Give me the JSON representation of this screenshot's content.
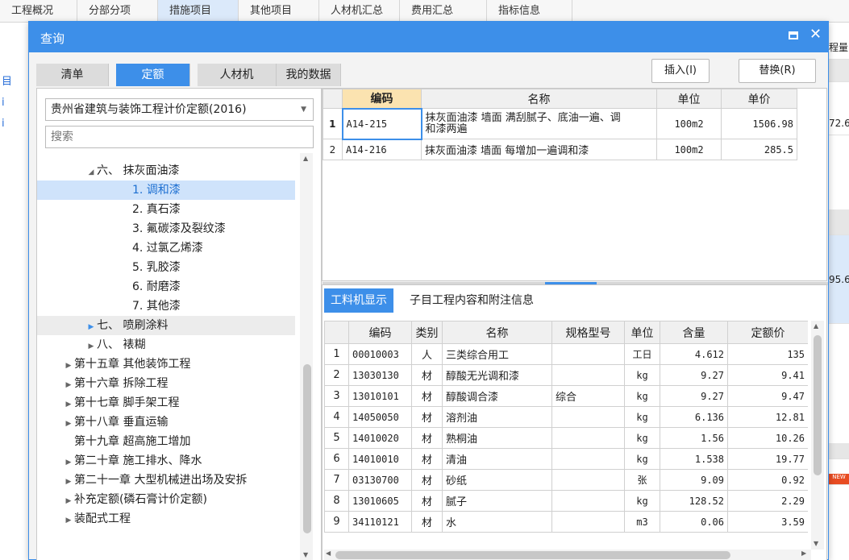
{
  "background": {
    "tabs": [
      "工程概况",
      "分部分项",
      "措施项目",
      "其他项目",
      "人材机汇总",
      "费用汇总",
      "指标信息"
    ],
    "left_items": [
      "目",
      "i",
      "i"
    ],
    "right_cells": [
      "程量",
      "72.6",
      "95.6",
      "NEW"
    ]
  },
  "dialog": {
    "title": "查询",
    "tabs": [
      {
        "label": "清单",
        "active": false
      },
      {
        "label": "定额",
        "active": true
      },
      {
        "label": "人材机",
        "active": false
      },
      {
        "label": "我的数据",
        "active": false
      }
    ],
    "insert_label": "插入(I)",
    "replace_label": "替换(R)"
  },
  "left": {
    "dataset": "贵州省建筑与装饰工程计价定额(2016)",
    "search_placeholder": "搜索",
    "tree": [
      {
        "label": "六、 抹灰面油漆",
        "indent": 60,
        "tri": "◢",
        "state": ""
      },
      {
        "label": "1. 调和漆",
        "indent": 104,
        "tri": "",
        "state": "selected"
      },
      {
        "label": "2. 真石漆",
        "indent": 104,
        "tri": "",
        "state": ""
      },
      {
        "label": "3. 氟碳漆及裂纹漆",
        "indent": 104,
        "tri": "",
        "state": ""
      },
      {
        "label": "4. 过氯乙烯漆",
        "indent": 104,
        "tri": "",
        "state": ""
      },
      {
        "label": "5. 乳胶漆",
        "indent": 104,
        "tri": "",
        "state": ""
      },
      {
        "label": "6. 耐磨漆",
        "indent": 104,
        "tri": "",
        "state": ""
      },
      {
        "label": "7. 其他漆",
        "indent": 104,
        "tri": "",
        "state": ""
      },
      {
        "label": "七、 喷刷涂料",
        "indent": 60,
        "tri": "▶",
        "state": "hover"
      },
      {
        "label": "八、 裱糊",
        "indent": 60,
        "tri": "▶",
        "state": ""
      },
      {
        "label": "第十五章 其他装饰工程",
        "indent": 32,
        "tri": "▶",
        "state": ""
      },
      {
        "label": "第十六章 拆除工程",
        "indent": 32,
        "tri": "▶",
        "state": ""
      },
      {
        "label": "第十七章 脚手架工程",
        "indent": 32,
        "tri": "▶",
        "state": ""
      },
      {
        "label": "第十八章 垂直运输",
        "indent": 32,
        "tri": "▶",
        "state": ""
      },
      {
        "label": "第十九章 超高施工增加",
        "indent": 32,
        "tri": "",
        "state": ""
      },
      {
        "label": "第二十章 施工排水、降水",
        "indent": 32,
        "tri": "▶",
        "state": ""
      },
      {
        "label": "第二十一章 大型机械进出场及安拆",
        "indent": 32,
        "tri": "▶",
        "state": ""
      },
      {
        "label": "补充定额(磷石膏计价定额)",
        "indent": 32,
        "tri": "▶",
        "state": ""
      },
      {
        "label": "装配式工程",
        "indent": 32,
        "tri": "▶",
        "state": ""
      }
    ]
  },
  "quota": {
    "headers": [
      "编码",
      "名称",
      "单位",
      "单价"
    ],
    "rows": [
      {
        "no": "1",
        "code": "A14-215",
        "name_line1": "抹灰面油漆 墙面 满刮腻子、底油一遍、调",
        "name_line2": "和漆两遍",
        "unit": "100m2",
        "price": "1506.98"
      },
      {
        "no": "2",
        "code": "A14-216",
        "name_line1": "抹灰面油漆 墙面 每增加一遍调和漆",
        "name_line2": "",
        "unit": "100m2",
        "price": "285.5"
      }
    ]
  },
  "detail": {
    "tabs": [
      "工料机显示",
      "子目工程内容和附注信息"
    ],
    "headers": [
      "编码",
      "类别",
      "名称",
      "规格型号",
      "单位",
      "含量",
      "定额价"
    ],
    "rows": [
      {
        "no": "1",
        "code": "00010003",
        "type": "人",
        "name": "三类综合用工",
        "spec": "",
        "unit": "工日",
        "qty": "4.612",
        "price": "135"
      },
      {
        "no": "2",
        "code": "13030130",
        "type": "材",
        "name": "醇酸无光调和漆",
        "spec": "",
        "unit": "kg",
        "qty": "9.27",
        "price": "9.41"
      },
      {
        "no": "3",
        "code": "13010101",
        "type": "材",
        "name": "醇酸调合漆",
        "spec": "综合",
        "unit": "kg",
        "qty": "9.27",
        "price": "9.47"
      },
      {
        "no": "4",
        "code": "14050050",
        "type": "材",
        "name": "溶剂油",
        "spec": "",
        "unit": "kg",
        "qty": "6.136",
        "price": "12.81"
      },
      {
        "no": "5",
        "code": "14010020",
        "type": "材",
        "name": "熟桐油",
        "spec": "",
        "unit": "kg",
        "qty": "1.56",
        "price": "10.26"
      },
      {
        "no": "6",
        "code": "14010010",
        "type": "材",
        "name": "清油",
        "spec": "",
        "unit": "kg",
        "qty": "1.538",
        "price": "19.77"
      },
      {
        "no": "7",
        "code": "03130700",
        "type": "材",
        "name": "砂纸",
        "spec": "",
        "unit": "张",
        "qty": "9.09",
        "price": "0.92"
      },
      {
        "no": "8",
        "code": "13010605",
        "type": "材",
        "name": "腻子",
        "spec": "",
        "unit": "kg",
        "qty": "128.52",
        "price": "2.29"
      },
      {
        "no": "9",
        "code": "34110121",
        "type": "材",
        "name": "水",
        "spec": "",
        "unit": "m3",
        "qty": "0.06",
        "price": "3.59"
      }
    ]
  },
  "colors": {
    "accent": "#3d8fe9",
    "selected_row": "#cfe3fb",
    "header_highlight": "#fbe3b0"
  }
}
